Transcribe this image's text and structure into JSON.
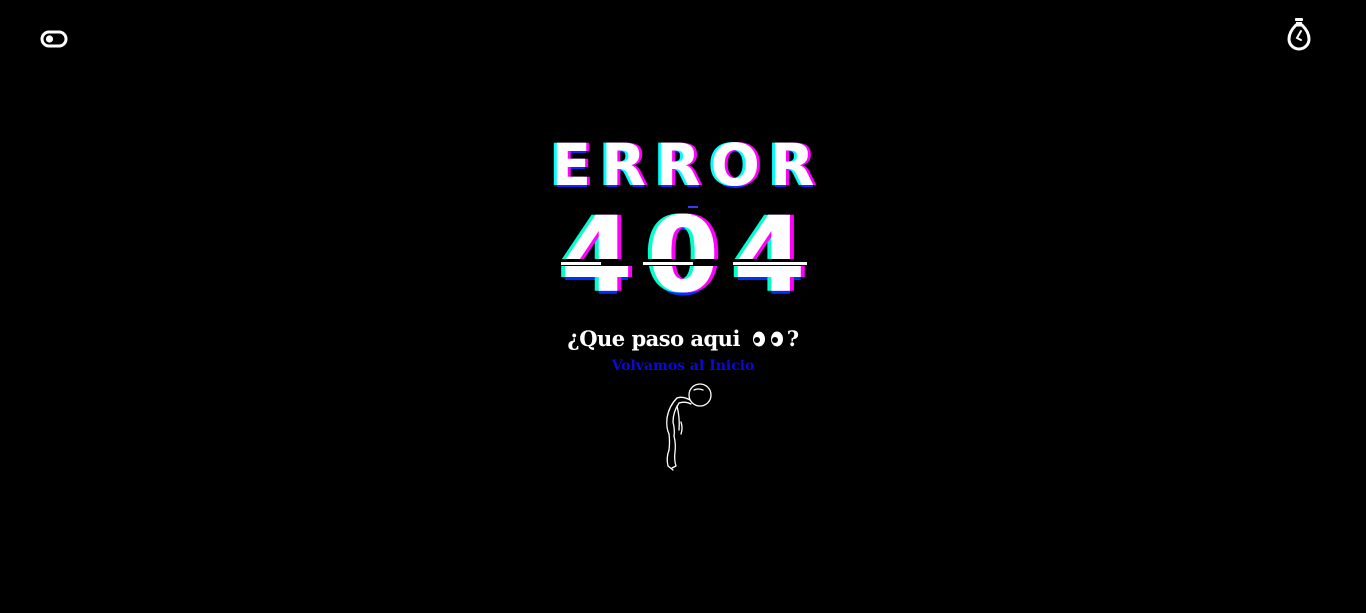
{
  "header": {
    "theme_toggle_icon": "toggle-switch-icon",
    "lamp_icon": "light-bulb-icon"
  },
  "error": {
    "word": "ERROR",
    "code": "404",
    "question": "¿Que paso aqui",
    "question_end": "?",
    "eyes_icon": "eyes-icon",
    "link_text": "Volvamos al Inicio",
    "illustration": "sad-person-illustration"
  },
  "colors": {
    "background": "#000000",
    "text": "#ffffff",
    "link": "#0a0ad8",
    "glitch_magenta": "#ff00ff",
    "glitch_cyan": "#00ffff"
  }
}
